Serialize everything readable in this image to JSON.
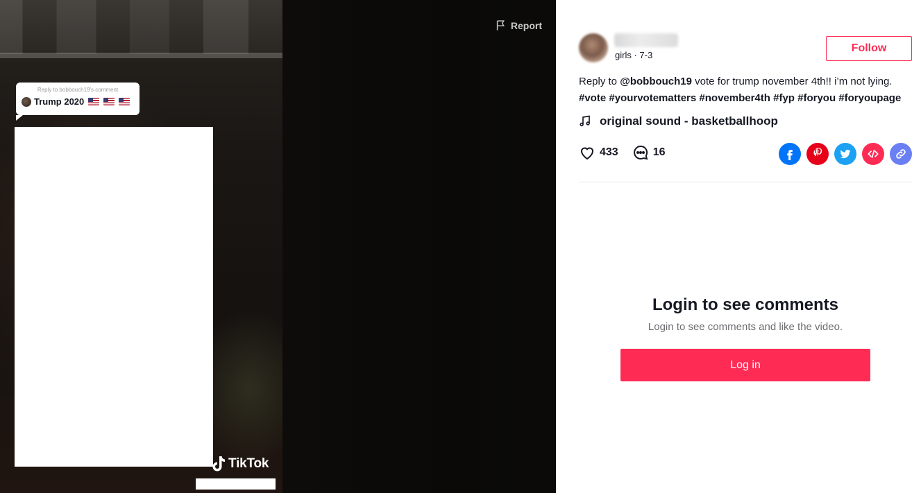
{
  "video": {
    "report_label": "Report",
    "reply_sticker": {
      "reply_to": "Reply to bobbouch19's comment",
      "text": "Trump 2020"
    },
    "watermark": "TikTok"
  },
  "author": {
    "username": "fairlydoughs",
    "meta": "girls · 7-3",
    "follow_label": "Follow"
  },
  "description": {
    "prefix": "Reply to",
    "mention": "@bobbouch19",
    "text": "vote for trump november 4th!! i’m not lying.",
    "hashtags": "#vote #yourvotematters #november4th #fyp #foryou #foryoupage"
  },
  "music": {
    "icon": "music-note-icon",
    "title": "original sound - basketballhoop"
  },
  "stats": {
    "likes": "433",
    "comments": "16"
  },
  "share": {
    "icons": [
      "facebook-icon",
      "pinterest-icon",
      "twitter-icon",
      "embed-icon",
      "link-icon"
    ],
    "colors": {
      "facebook": "#0075FA",
      "pinterest": "#E60019",
      "twitter": "#1DA1F2",
      "embed": "#FE2C55",
      "link": "#6A7FF4"
    }
  },
  "comments_gate": {
    "title": "Login to see comments",
    "subtitle": "Login to see comments and like the video.",
    "login_label": "Log in"
  },
  "colors": {
    "accent": "#FE2C55",
    "text": "#161823"
  }
}
